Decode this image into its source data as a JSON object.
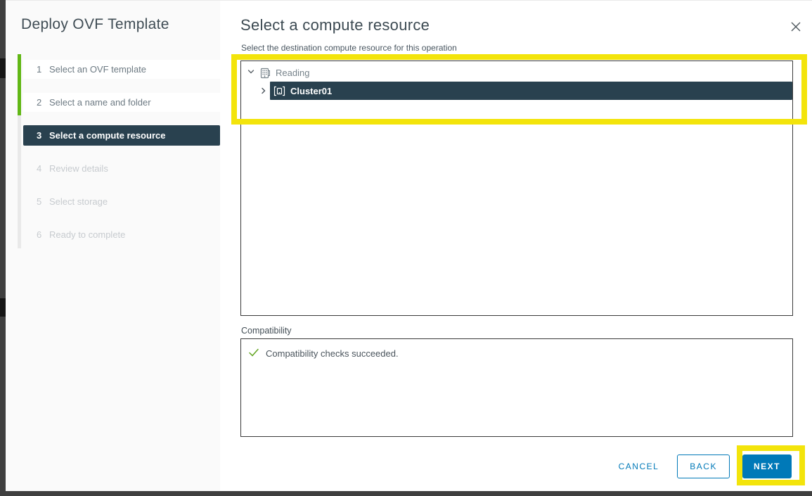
{
  "wizard": {
    "title": "Deploy OVF Template",
    "steps": [
      {
        "num": "1",
        "label": "Select an OVF template",
        "status": "completed"
      },
      {
        "num": "2",
        "label": "Select a name and folder",
        "status": "completed"
      },
      {
        "num": "3",
        "label": "Select a compute resource",
        "status": "active"
      },
      {
        "num": "4",
        "label": "Review details",
        "status": "disabled"
      },
      {
        "num": "5",
        "label": "Select storage",
        "status": "disabled"
      },
      {
        "num": "6",
        "label": "Ready to complete",
        "status": "disabled"
      }
    ]
  },
  "panel": {
    "heading": "Select a compute resource",
    "subheading": "Select the destination compute resource for this operation",
    "close_icon": "close-icon"
  },
  "tree": {
    "datacenter": {
      "label": "Reading",
      "icon": "datacenter-icon",
      "expanded": true
    },
    "cluster": {
      "label": "Cluster01",
      "icon": "cluster-icon",
      "selected": true,
      "collapsed": true
    }
  },
  "compatibility": {
    "label": "Compatibility",
    "message": "Compatibility checks succeeded.",
    "status_icon": "check-icon"
  },
  "footer": {
    "cancel_label": "CANCEL",
    "back_label": "BACK",
    "next_label": "NEXT"
  },
  "colors": {
    "accent_blue": "#0079b8",
    "selection_navy": "#29414f",
    "progress_green": "#61b715",
    "check_green": "#62a420",
    "highlight_yellow": "#f3e40b",
    "sidebar_bg": "#fafafa"
  }
}
